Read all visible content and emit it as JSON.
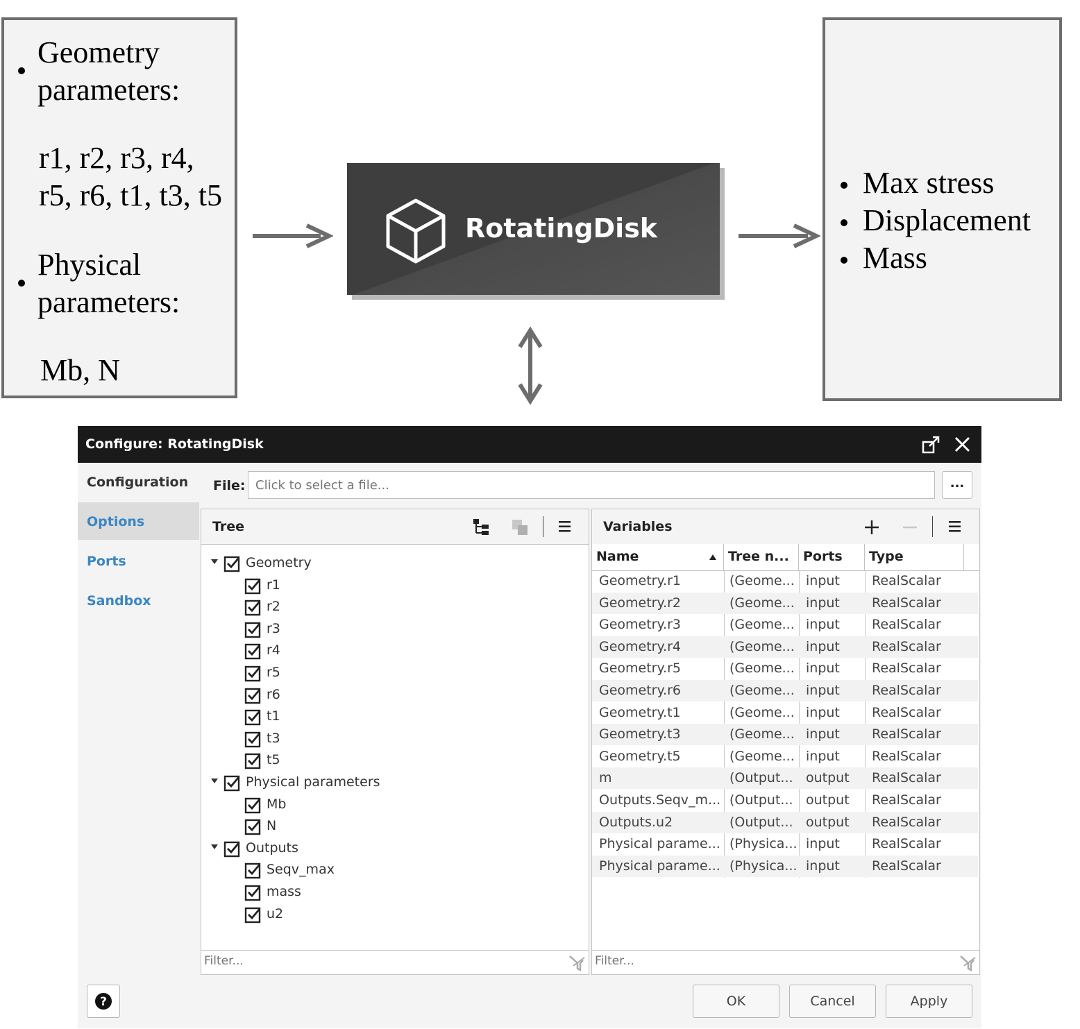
{
  "inputs_box": {
    "geometry_label_1": "Geometry",
    "geometry_label_2": "parameters:",
    "geometry_params_1": "r1, r2, r3, r4,",
    "geometry_params_2": "r5, r6, t1, t3, t5",
    "physical_label_1": "Physical",
    "physical_label_2": "parameters:",
    "physical_params": "Mb, N"
  },
  "block": {
    "title": "RotatingDisk",
    "icon": "cube-icon"
  },
  "outputs_box": {
    "items": [
      "Max stress",
      "Displacement",
      "Mass"
    ]
  },
  "dialog": {
    "title": "Configure: RotatingDisk",
    "nav": [
      "Configuration",
      "Options",
      "Ports",
      "Sandbox"
    ],
    "active_nav": "Configuration",
    "file_label": "File:",
    "file_placeholder": "Click to select a file...",
    "browse_label": "...",
    "tree_title": "Tree",
    "variables_title": "Variables",
    "filter_placeholder": "Filter...",
    "tree": [
      {
        "label": "Geometry",
        "level": 0,
        "expanded": true
      },
      {
        "label": "r1",
        "level": 1
      },
      {
        "label": "r2",
        "level": 1
      },
      {
        "label": "r3",
        "level": 1
      },
      {
        "label": "r4",
        "level": 1
      },
      {
        "label": "r5",
        "level": 1
      },
      {
        "label": "r6",
        "level": 1
      },
      {
        "label": "t1",
        "level": 1
      },
      {
        "label": "t3",
        "level": 1
      },
      {
        "label": "t5",
        "level": 1
      },
      {
        "label": "Physical parameters",
        "level": 0,
        "expanded": true
      },
      {
        "label": "Mb",
        "level": 1
      },
      {
        "label": "N",
        "level": 1
      },
      {
        "label": "Outputs",
        "level": 0,
        "expanded": true
      },
      {
        "label": "Seqv_max",
        "level": 1
      },
      {
        "label": "mass",
        "level": 1
      },
      {
        "label": "u2",
        "level": 1
      }
    ],
    "columns": [
      "Name",
      "Tree n...",
      "Ports",
      "Type"
    ],
    "rows": [
      [
        "Geometry.r1",
        "(Geome...",
        "input",
        "RealScalar"
      ],
      [
        "Geometry.r2",
        "(Geome...",
        "input",
        "RealScalar"
      ],
      [
        "Geometry.r3",
        "(Geome...",
        "input",
        "RealScalar"
      ],
      [
        "Geometry.r4",
        "(Geome...",
        "input",
        "RealScalar"
      ],
      [
        "Geometry.r5",
        "(Geome...",
        "input",
        "RealScalar"
      ],
      [
        "Geometry.r6",
        "(Geome...",
        "input",
        "RealScalar"
      ],
      [
        "Geometry.t1",
        "(Geome...",
        "input",
        "RealScalar"
      ],
      [
        "Geometry.t3",
        "(Geome...",
        "input",
        "RealScalar"
      ],
      [
        "Geometry.t5",
        "(Geome...",
        "input",
        "RealScalar"
      ],
      [
        "m",
        "(Output...",
        "output",
        "RealScalar"
      ],
      [
        "Outputs.Seqv_m...",
        "(Output...",
        "output",
        "RealScalar"
      ],
      [
        "Outputs.u2",
        "(Output...",
        "output",
        "RealScalar"
      ],
      [
        "Physical parame...",
        "(Physica...",
        "input",
        "RealScalar"
      ],
      [
        "Physical parame...",
        "(Physica...",
        "input",
        "RealScalar"
      ]
    ],
    "buttons": {
      "ok": "OK",
      "cancel": "Cancel",
      "apply": "Apply"
    }
  }
}
